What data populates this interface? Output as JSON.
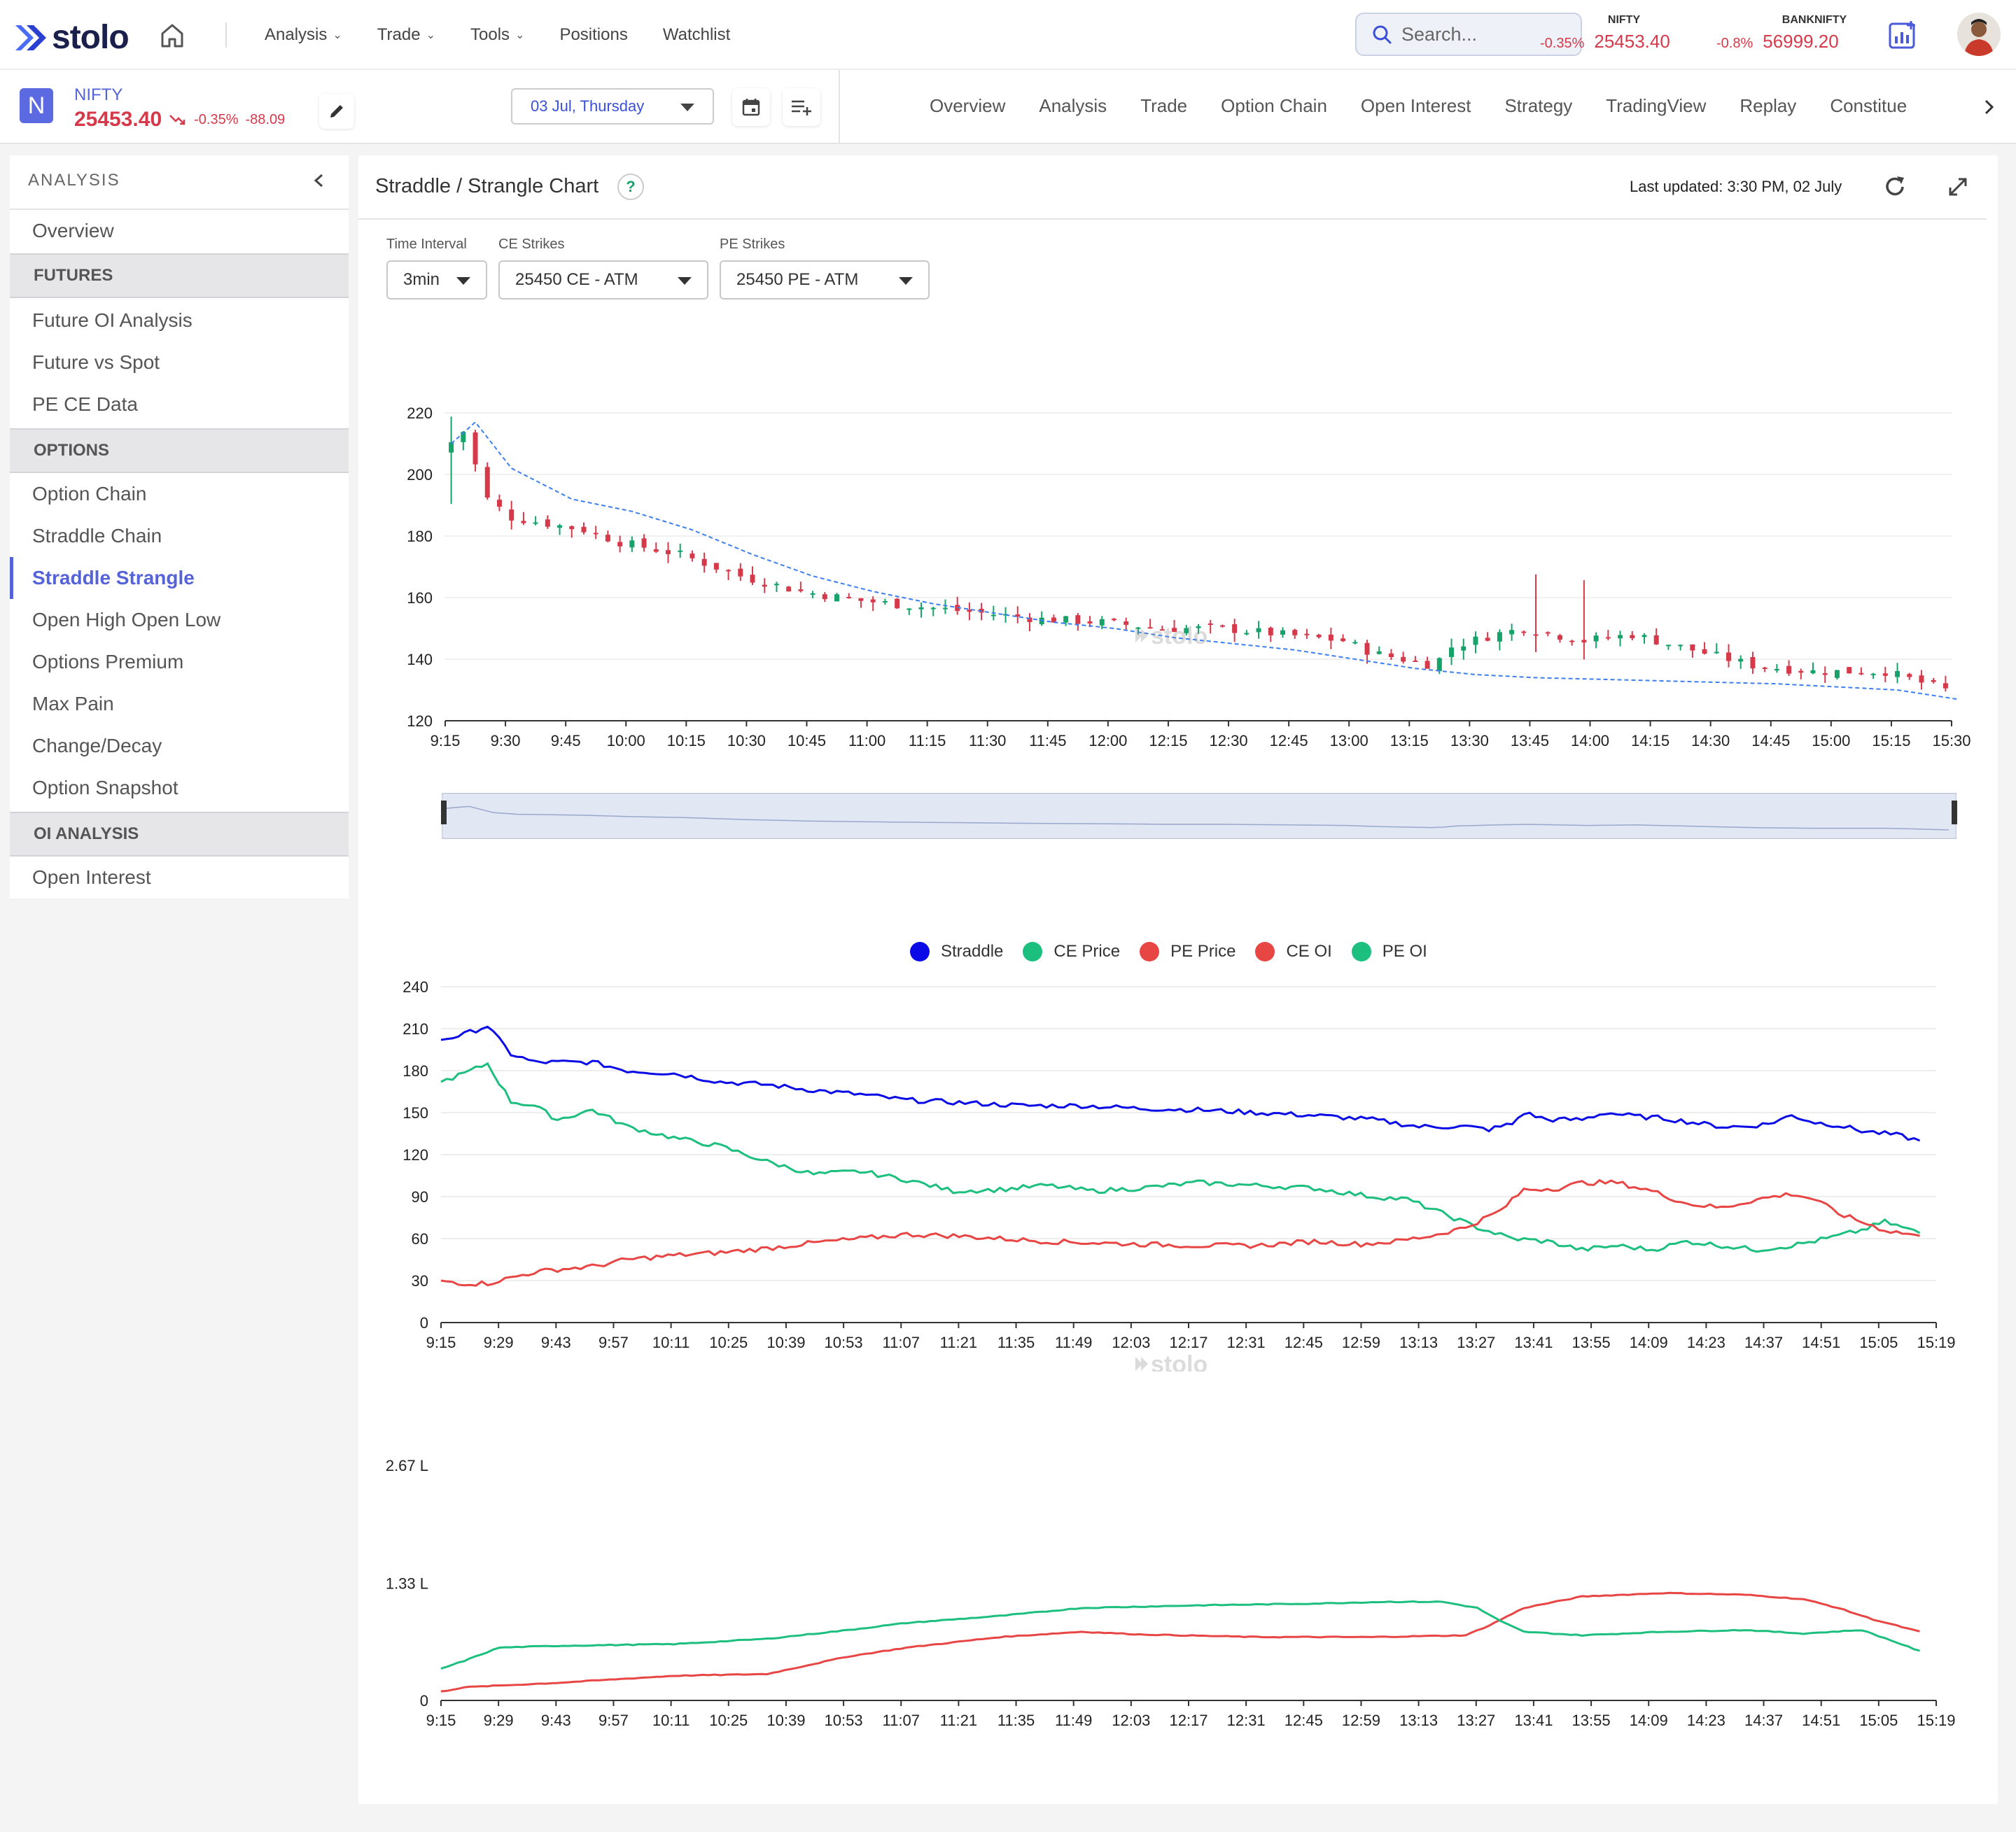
{
  "topnav": {
    "brand": "stolo",
    "menu": [
      {
        "label": "Analysis",
        "dropdown": true
      },
      {
        "label": "Trade",
        "dropdown": true
      },
      {
        "label": "Tools",
        "dropdown": true
      },
      {
        "label": "Positions",
        "dropdown": false
      },
      {
        "label": "Watchlist",
        "dropdown": false
      }
    ],
    "search_placeholder": "Search...",
    "indices": [
      {
        "name": "NIFTY",
        "change_pct": "-0.35%",
        "value": "25453.40"
      },
      {
        "name": "BANKNIFTY",
        "change_pct": "-0.8%",
        "value": "56999.20"
      }
    ],
    "icons": [
      "home-icon",
      "search-icon",
      "add-chart-icon",
      "user-avatar"
    ]
  },
  "instrument": {
    "avatar_letter": "N",
    "name": "NIFTY",
    "price": "25453.40",
    "change_pct": "-0.35%",
    "change_abs": "-88.09",
    "date": "03 Jul, Thursday"
  },
  "tabs": [
    "Overview",
    "Analysis",
    "Trade",
    "Option Chain",
    "Open Interest",
    "Strategy",
    "TradingView",
    "Replay",
    "Constitue"
  ],
  "sidebar": {
    "title": "ANALYSIS",
    "items": [
      {
        "type": "item",
        "label": "Overview"
      },
      {
        "type": "section",
        "label": "FUTURES"
      },
      {
        "type": "item",
        "label": "Future OI Analysis"
      },
      {
        "type": "item",
        "label": "Future vs Spot"
      },
      {
        "type": "item",
        "label": "PE CE Data"
      },
      {
        "type": "section",
        "label": "OPTIONS"
      },
      {
        "type": "item",
        "label": "Option Chain"
      },
      {
        "type": "item",
        "label": "Straddle Chain"
      },
      {
        "type": "item",
        "label": "Straddle Strangle",
        "active": true
      },
      {
        "type": "item",
        "label": "Open High Open Low"
      },
      {
        "type": "item",
        "label": "Options Premium"
      },
      {
        "type": "item",
        "label": "Max Pain"
      },
      {
        "type": "item",
        "label": "Change/Decay"
      },
      {
        "type": "item",
        "label": "Option Snapshot"
      },
      {
        "type": "section",
        "label": "OI ANALYSIS"
      },
      {
        "type": "item",
        "label": "Open Interest"
      }
    ]
  },
  "panel": {
    "title": "Straddle / Strangle Chart",
    "help": "?",
    "last_updated": "Last updated: 3:30 PM, 02 July",
    "filters": [
      {
        "label": "Time Interval",
        "value": "3min"
      },
      {
        "label": "CE Strikes",
        "value": "25450 CE - ATM"
      },
      {
        "label": "PE Strikes",
        "value": "25450 PE - ATM"
      }
    ],
    "watermark": "stolo"
  },
  "colors": {
    "accent": "#5563d8",
    "up": "#16a36a",
    "down": "#d63a4a",
    "straddle": "#0a0ae6",
    "ce_price": "#1dbf7f",
    "pe_price": "#e84545",
    "ce_oi": "#e84545",
    "pe_oi": "#1dbf7f",
    "trend": "#3d7ff0"
  },
  "chart_data": [
    {
      "type": "candlestick",
      "x_ticks": [
        "9:15",
        "9:30",
        "9:45",
        "10:00",
        "10:15",
        "10:30",
        "10:45",
        "11:00",
        "11:15",
        "11:30",
        "11:45",
        "12:00",
        "12:15",
        "12:30",
        "12:45",
        "13:00",
        "13:15",
        "13:30",
        "13:45",
        "14:00",
        "14:15",
        "14:30",
        "14:45",
        "15:00",
        "15:15",
        "15:30"
      ],
      "y_ticks": [
        120,
        140,
        160,
        180,
        200,
        220
      ],
      "ylim": [
        120,
        220
      ],
      "close_path": [
        [
          0,
          207
        ],
        [
          4,
          214
        ],
        [
          8,
          192
        ],
        [
          12,
          186
        ],
        [
          18,
          184
        ],
        [
          24,
          182
        ],
        [
          30,
          178
        ],
        [
          40,
          174
        ],
        [
          50,
          167
        ],
        [
          60,
          162
        ],
        [
          70,
          159
        ],
        [
          80,
          157
        ],
        [
          90,
          155
        ],
        [
          100,
          153
        ],
        [
          110,
          152
        ],
        [
          120,
          150
        ],
        [
          130,
          150
        ],
        [
          140,
          148
        ],
        [
          150,
          146
        ],
        [
          155,
          142
        ],
        [
          160,
          140
        ],
        [
          165,
          138
        ],
        [
          168,
          144
        ],
        [
          175,
          148
        ],
        [
          180,
          150
        ],
        [
          190,
          146
        ],
        [
          198,
          148
        ],
        [
          208,
          143
        ],
        [
          218,
          138
        ],
        [
          228,
          136
        ],
        [
          240,
          136
        ],
        [
          250,
          130
        ]
      ],
      "trend_path": [
        [
          0,
          210
        ],
        [
          4,
          217
        ],
        [
          10,
          202
        ],
        [
          20,
          192
        ],
        [
          30,
          188
        ],
        [
          40,
          182
        ],
        [
          50,
          174
        ],
        [
          60,
          167
        ],
        [
          70,
          162
        ],
        [
          80,
          158
        ],
        [
          90,
          155
        ],
        [
          100,
          152
        ],
        [
          110,
          150
        ],
        [
          120,
          147
        ],
        [
          130,
          145
        ],
        [
          140,
          143
        ],
        [
          150,
          140
        ],
        [
          160,
          137
        ],
        [
          170,
          135
        ],
        [
          180,
          134
        ],
        [
          200,
          133
        ],
        [
          220,
          132
        ],
        [
          240,
          130
        ],
        [
          250,
          127
        ]
      ],
      "ohlc_note": "candles generated around close path"
    },
    {
      "type": "line",
      "legend": [
        "Straddle",
        "CE Price",
        "PE Price",
        "CE OI",
        "PE OI"
      ],
      "x_ticks": [
        "9:15",
        "9:29",
        "9:43",
        "9:57",
        "10:11",
        "10:25",
        "10:39",
        "10:53",
        "11:07",
        "11:21",
        "11:35",
        "11:49",
        "12:03",
        "12:17",
        "12:31",
        "12:45",
        "12:59",
        "13:13",
        "13:27",
        "13:41",
        "13:55",
        "14:09",
        "14:23",
        "14:37",
        "14:51",
        "15:05",
        "15:19"
      ],
      "y_ticks": [
        0,
        30,
        60,
        90,
        120,
        150,
        180,
        210,
        240
      ],
      "ylim": [
        0,
        240
      ],
      "series": [
        {
          "name": "Straddle",
          "points": [
            [
              0,
              202
            ],
            [
              4,
              206
            ],
            [
              8,
              212
            ],
            [
              12,
              192
            ],
            [
              16,
              186
            ],
            [
              20,
              186
            ],
            [
              26,
              186
            ],
            [
              32,
              180
            ],
            [
              40,
              178
            ],
            [
              48,
              172
            ],
            [
              56,
              170
            ],
            [
              64,
              166
            ],
            [
              72,
              163
            ],
            [
              80,
              159
            ],
            [
              90,
              157
            ],
            [
              100,
              155
            ],
            [
              110,
              155
            ],
            [
              120,
              153
            ],
            [
              130,
              152
            ],
            [
              140,
              150
            ],
            [
              150,
              148
            ],
            [
              160,
              145
            ],
            [
              168,
              140
            ],
            [
              176,
              140
            ],
            [
              180,
              138
            ],
            [
              184,
              142
            ],
            [
              186,
              150
            ],
            [
              190,
              145
            ],
            [
              196,
              145
            ],
            [
              200,
              150
            ],
            [
              206,
              147
            ],
            [
              210,
              146
            ],
            [
              215,
              143
            ],
            [
              220,
              140
            ],
            [
              224,
              140
            ],
            [
              228,
              142
            ],
            [
              232,
              148
            ],
            [
              236,
              143
            ],
            [
              240,
              141
            ],
            [
              244,
              137
            ],
            [
              250,
              134
            ],
            [
              254,
              130
            ]
          ]
        },
        {
          "name": "CE Price",
          "points": [
            [
              0,
              172
            ],
            [
              4,
              178
            ],
            [
              8,
              185
            ],
            [
              12,
              158
            ],
            [
              16,
              155
            ],
            [
              20,
              145
            ],
            [
              26,
              152
            ],
            [
              32,
              140
            ],
            [
              40,
              132
            ],
            [
              48,
              126
            ],
            [
              56,
              115
            ],
            [
              64,
              106
            ],
            [
              72,
              108
            ],
            [
              80,
              102
            ],
            [
              88,
              94
            ],
            [
              96,
              95
            ],
            [
              104,
              98
            ],
            [
              112,
              94
            ],
            [
              120,
              96
            ],
            [
              130,
              100
            ],
            [
              140,
              98
            ],
            [
              150,
              96
            ],
            [
              160,
              90
            ],
            [
              166,
              88
            ],
            [
              172,
              78
            ],
            [
              178,
              68
            ],
            [
              184,
              60
            ],
            [
              190,
              58
            ],
            [
              196,
              52
            ],
            [
              202,
              55
            ],
            [
              208,
              52
            ],
            [
              214,
              58
            ],
            [
              220,
              55
            ],
            [
              226,
              52
            ],
            [
              232,
              55
            ],
            [
              238,
              60
            ],
            [
              244,
              66
            ],
            [
              248,
              72
            ],
            [
              254,
              64
            ]
          ]
        },
        {
          "name": "PE Price",
          "points": [
            [
              0,
              30
            ],
            [
              4,
              28
            ],
            [
              8,
              28
            ],
            [
              12,
              32
            ],
            [
              16,
              36
            ],
            [
              20,
              38
            ],
            [
              26,
              40
            ],
            [
              32,
              45
            ],
            [
              40,
              48
            ],
            [
              48,
              50
            ],
            [
              56,
              53
            ],
            [
              64,
              57
            ],
            [
              72,
              60
            ],
            [
              80,
              63
            ],
            [
              88,
              62
            ],
            [
              96,
              60
            ],
            [
              104,
              58
            ],
            [
              112,
              57
            ],
            [
              120,
              56
            ],
            [
              130,
              55
            ],
            [
              140,
              55
            ],
            [
              150,
              58
            ],
            [
              158,
              56
            ],
            [
              164,
              58
            ],
            [
              170,
              62
            ],
            [
              176,
              68
            ],
            [
              182,
              80
            ],
            [
              186,
              95
            ],
            [
              192,
              96
            ],
            [
              196,
              100
            ],
            [
              202,
              100
            ],
            [
              208,
              94
            ],
            [
              214,
              85
            ],
            [
              220,
              82
            ],
            [
              226,
              88
            ],
            [
              232,
              92
            ],
            [
              236,
              88
            ],
            [
              240,
              78
            ],
            [
              244,
              72
            ],
            [
              248,
              66
            ],
            [
              254,
              62
            ]
          ]
        }
      ]
    },
    {
      "type": "line",
      "x_ticks": [
        "9:15",
        "9:29",
        "9:43",
        "9:57",
        "10:11",
        "10:25",
        "10:39",
        "10:53",
        "11:07",
        "11:21",
        "11:35",
        "11:49",
        "12:03",
        "12:17",
        "12:31",
        "12:45",
        "12:59",
        "13:13",
        "13:27",
        "13:41",
        "13:55",
        "14:09",
        "14:23",
        "14:37",
        "14:51",
        "15:05",
        "15:19"
      ],
      "y_ticks": [
        "0",
        "1.33 L",
        "2.67 L"
      ],
      "ylim": [
        0,
        2.67
      ],
      "series": [
        {
          "name": "CE OI",
          "points": [
            [
              0,
              0.1
            ],
            [
              4,
              0.15
            ],
            [
              20,
              0.2
            ],
            [
              40,
              0.28
            ],
            [
              56,
              0.3
            ],
            [
              70,
              0.5
            ],
            [
              80,
              0.6
            ],
            [
              96,
              0.72
            ],
            [
              110,
              0.78
            ],
            [
              120,
              0.75
            ],
            [
              140,
              0.72
            ],
            [
              160,
              0.72
            ],
            [
              176,
              0.74
            ],
            [
              180,
              0.85
            ],
            [
              186,
              1.05
            ],
            [
              196,
              1.18
            ],
            [
              210,
              1.22
            ],
            [
              224,
              1.2
            ],
            [
              234,
              1.15
            ],
            [
              240,
              1.05
            ],
            [
              246,
              0.92
            ],
            [
              254,
              0.78
            ]
          ]
        },
        {
          "name": "PE OI",
          "points": [
            [
              0,
              0.36
            ],
            [
              4,
              0.45
            ],
            [
              10,
              0.6
            ],
            [
              20,
              0.62
            ],
            [
              40,
              0.64
            ],
            [
              56,
              0.7
            ],
            [
              70,
              0.8
            ],
            [
              80,
              0.88
            ],
            [
              96,
              0.96
            ],
            [
              110,
              1.05
            ],
            [
              130,
              1.08
            ],
            [
              150,
              1.1
            ],
            [
              162,
              1.12
            ],
            [
              172,
              1.12
            ],
            [
              178,
              1.05
            ],
            [
              182,
              0.9
            ],
            [
              186,
              0.78
            ],
            [
              196,
              0.74
            ],
            [
              210,
              0.78
            ],
            [
              224,
              0.8
            ],
            [
              234,
              0.76
            ],
            [
              244,
              0.8
            ],
            [
              250,
              0.66
            ],
            [
              254,
              0.56
            ]
          ]
        }
      ]
    }
  ]
}
